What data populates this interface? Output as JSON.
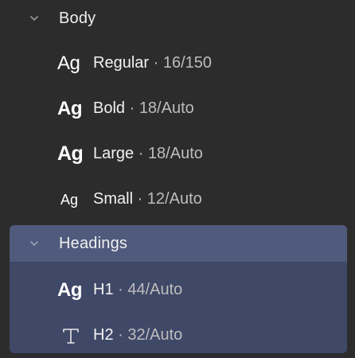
{
  "groups": [
    {
      "label": "Body",
      "expanded": true,
      "styles": [
        {
          "glyph": "Ag",
          "weight": "regular",
          "name": "Regular",
          "meta": "16/150"
        },
        {
          "glyph": "Ag",
          "weight": "bold",
          "name": "Bold",
          "meta": "18/Auto"
        },
        {
          "glyph": "Ag",
          "weight": "large",
          "name": "Large",
          "meta": "18/Auto"
        },
        {
          "glyph": "Ag",
          "weight": "small",
          "name": "Small",
          "meta": "12/Auto"
        }
      ]
    },
    {
      "label": "Headings",
      "expanded": true,
      "selected": true,
      "styles": [
        {
          "glyph": "Ag",
          "weight": "h1",
          "name": "H1",
          "meta": "44/Auto"
        },
        {
          "glyph_icon": "text-icon",
          "name": "H2",
          "meta": "32/Auto"
        }
      ]
    }
  ],
  "separator": " · ",
  "colors": {
    "background": "#2c2c2c",
    "selection": "#3f4867",
    "selection_header": "#4f5a7c",
    "chevron": "#9a9a9a"
  }
}
